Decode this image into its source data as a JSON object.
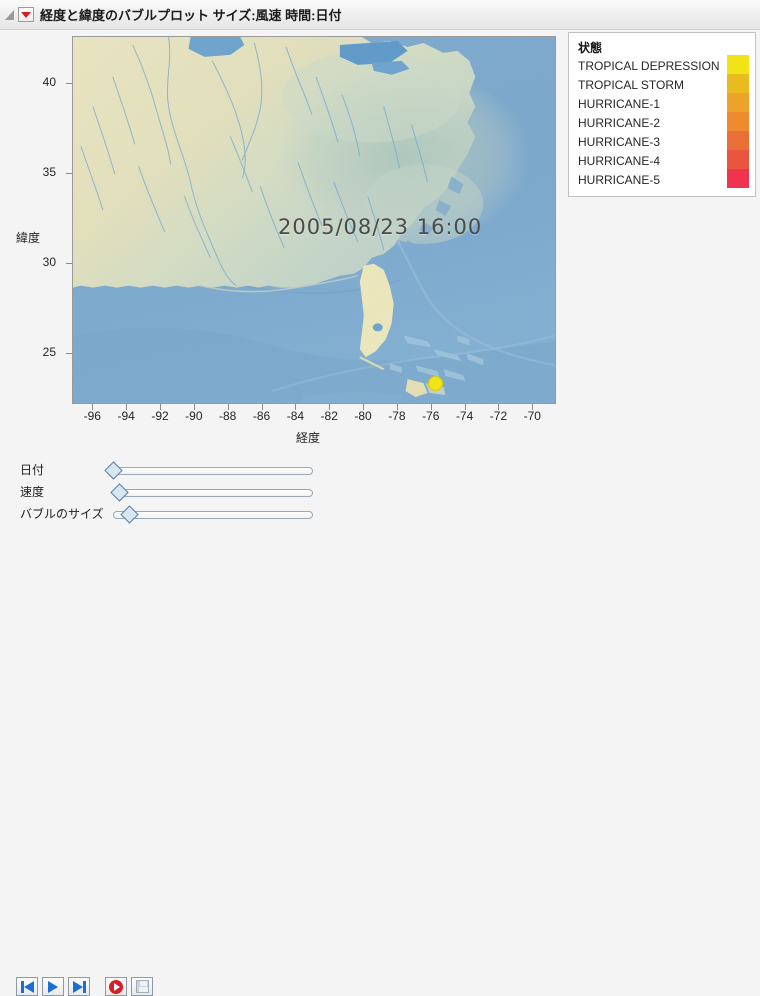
{
  "window": {
    "title": "経度と緯度のバブルプロット サイズ:風速 時間:日付",
    "outline_icon": "outline-triangle-icon",
    "disclosure_icon": "red-disclosure-triangle-icon"
  },
  "chart_data": {
    "type": "scatter",
    "title": "経度と緯度のバブルプロット サイズ:風速 時間:日付",
    "xlabel": "経度",
    "ylabel": "緯度",
    "xlim": [
      -97.2,
      -68.6
    ],
    "ylim": [
      22.2,
      42.6
    ],
    "xticks": [
      -96,
      -94,
      -92,
      -90,
      -88,
      -86,
      -84,
      -82,
      -80,
      -78,
      -76,
      -74,
      -72,
      -70
    ],
    "yticks": [
      25,
      30,
      35,
      40
    ],
    "grid": false,
    "background": "terrain-map",
    "annotation": "2005/08/23 16:00",
    "legend_position": "right",
    "points": [
      {
        "x": -75.8,
        "y": 23.4,
        "size": 15,
        "status": "TROPICAL DEPRESSION",
        "color": "#f2e316"
      }
    ],
    "series": [
      {
        "name": "TROPICAL DEPRESSION",
        "color": "#f2e316"
      },
      {
        "name": "TROPICAL STORM",
        "color": "#e8bb1e"
      },
      {
        "name": "HURRICANE-1",
        "color": "#eda229"
      },
      {
        "name": "HURRICANE-2",
        "color": "#ed8b2e"
      },
      {
        "name": "HURRICANE-3",
        "color": "#ea7038"
      },
      {
        "name": "HURRICANE-4",
        "color": "#ea5540"
      },
      {
        "name": "HURRICANE-5",
        "color": "#f0334f"
      }
    ]
  },
  "legend": {
    "title": "状態",
    "items": [
      {
        "label": "TROPICAL DEPRESSION",
        "color": "#f2e316"
      },
      {
        "label": "TROPICAL STORM",
        "color": "#e8bb1e"
      },
      {
        "label": "HURRICANE-1",
        "color": "#eda229"
      },
      {
        "label": "HURRICANE-2",
        "color": "#ed8b2e"
      },
      {
        "label": "HURRICANE-3",
        "color": "#ea7038"
      },
      {
        "label": "HURRICANE-4",
        "color": "#ea5540"
      },
      {
        "label": "HURRICANE-5",
        "color": "#f0334f"
      }
    ]
  },
  "controls": {
    "sliders": [
      {
        "label": "日付",
        "value_pct": 0
      },
      {
        "label": "速度",
        "value_pct": 3
      },
      {
        "label": "バブルのサイズ",
        "value_pct": 8
      }
    ],
    "buttons": [
      {
        "name": "step-back-button",
        "icon": "step-backward-icon",
        "enabled": true
      },
      {
        "name": "play-button",
        "icon": "play-icon",
        "enabled": true
      },
      {
        "name": "step-forward-button",
        "icon": "step-forward-icon",
        "enabled": true
      },
      {
        "name": "record-button",
        "icon": "record-icon",
        "enabled": true
      },
      {
        "name": "save-button",
        "icon": "floppy-disk-icon",
        "enabled": false
      }
    ]
  }
}
